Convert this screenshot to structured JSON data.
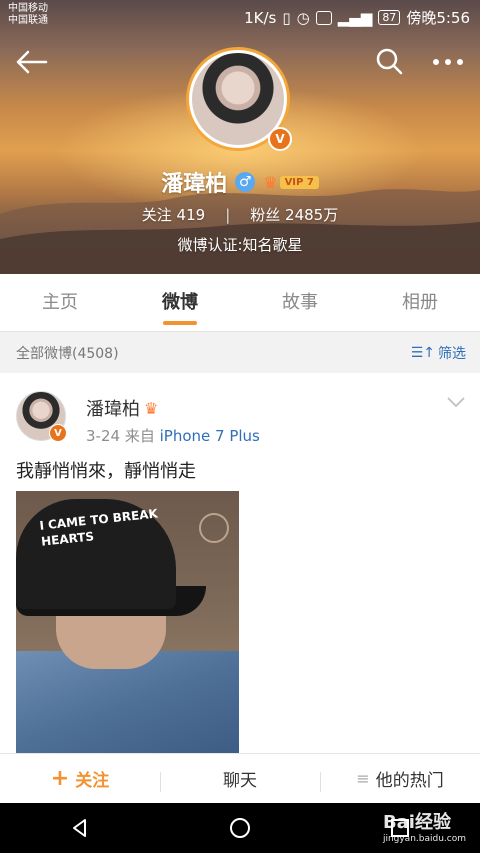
{
  "status_bar": {
    "carrier_1": "中国移动",
    "carrier_2": "中国联通",
    "speed": "1K/s",
    "battery": "87",
    "time": "傍晚5:56"
  },
  "profile": {
    "name": "潘瑋柏",
    "vip_level": "VIP 7",
    "following_label": "关注",
    "following_count": "419",
    "fans_label": "粉丝",
    "fans_count": "2485万",
    "verification": "微博认证:知名歌星"
  },
  "tabs": [
    {
      "label": "主页",
      "active": false
    },
    {
      "label": "微博",
      "active": true
    },
    {
      "label": "故事",
      "active": false
    },
    {
      "label": "相册",
      "active": false
    }
  ],
  "filter_bar": {
    "title": "全部微博(4508)",
    "filter_label": "筛选"
  },
  "post": {
    "author": "潘瑋柏",
    "date": "3-24",
    "source_prefix": "来自",
    "source": "iPhone 7 Plus",
    "text": "我靜悄悄來，靜悄悄走",
    "image_caption": "I CAME TO BREAK HEARTS"
  },
  "action_bar": {
    "follow": "关注",
    "chat": "聊天",
    "hot": "他的热门"
  },
  "watermark": {
    "brand": "Bai经验",
    "url": "jingyan.baidu.com"
  },
  "colors": {
    "accent": "#f39230",
    "link": "#2f6fb8",
    "verified": "#e8731d"
  }
}
